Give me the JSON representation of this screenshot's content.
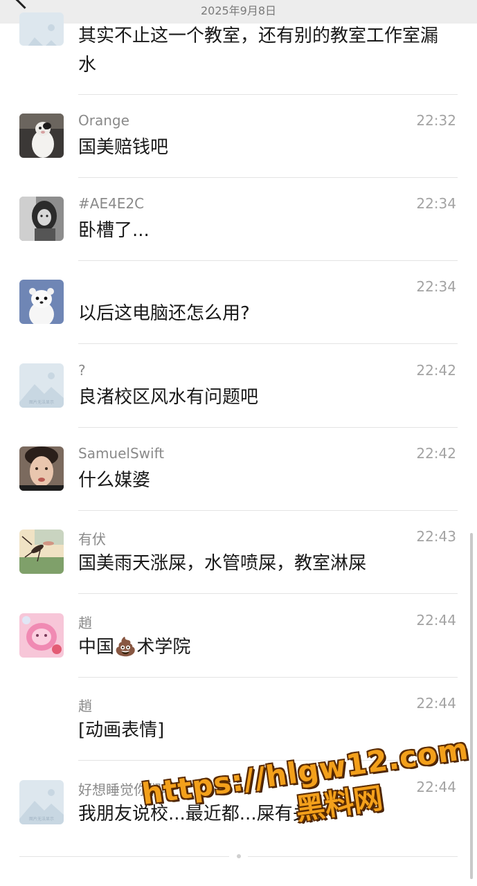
{
  "header": {
    "date": "2025年9月8日"
  },
  "messages": [
    {
      "sender": "",
      "time": "",
      "text": "其实不止这一个教室，还有别的教室工作室漏水",
      "avatar": "placeholder-image-icon"
    },
    {
      "sender": "Orange",
      "time": "22:32",
      "text": "国美赔钱吧",
      "avatar": "cat-avatar"
    },
    {
      "sender": "#AE4E2C",
      "time": "22:34",
      "text": "卧槽了...",
      "avatar": "portrait-avatar"
    },
    {
      "sender": "",
      "time": "22:34",
      "text": "以后这电脑还怎么用?",
      "avatar": "ermine-avatar"
    },
    {
      "sender": "?",
      "time": "22:42",
      "text": "良渚校区风水有问题吧",
      "avatar": "placeholder-image-icon"
    },
    {
      "sender": "SamuelSwift",
      "time": "22:42",
      "text": "什么媒婆",
      "avatar": "face-avatar"
    },
    {
      "sender": "有伏",
      "time": "22:43",
      "text": "国美雨天涨屎，水管喷屎，教室淋屎",
      "avatar": "mosquito-avatar"
    },
    {
      "sender": "趙",
      "time": "22:44",
      "text": "中国💩术学院",
      "avatar": "pink-avatar"
    },
    {
      "sender": "趙",
      "time": "22:44",
      "text": "[动画表情]",
      "avatar": ""
    },
    {
      "sender": "好想睡觉你们呢",
      "time": "22:44",
      "text": "我朋友说校...最近都...屎有关系",
      "avatar": "placeholder-image-icon"
    }
  ],
  "placeholder_caption": "图片无法显示",
  "watermark": {
    "url": "https://hlgw12.com",
    "name": "黑料网"
  }
}
